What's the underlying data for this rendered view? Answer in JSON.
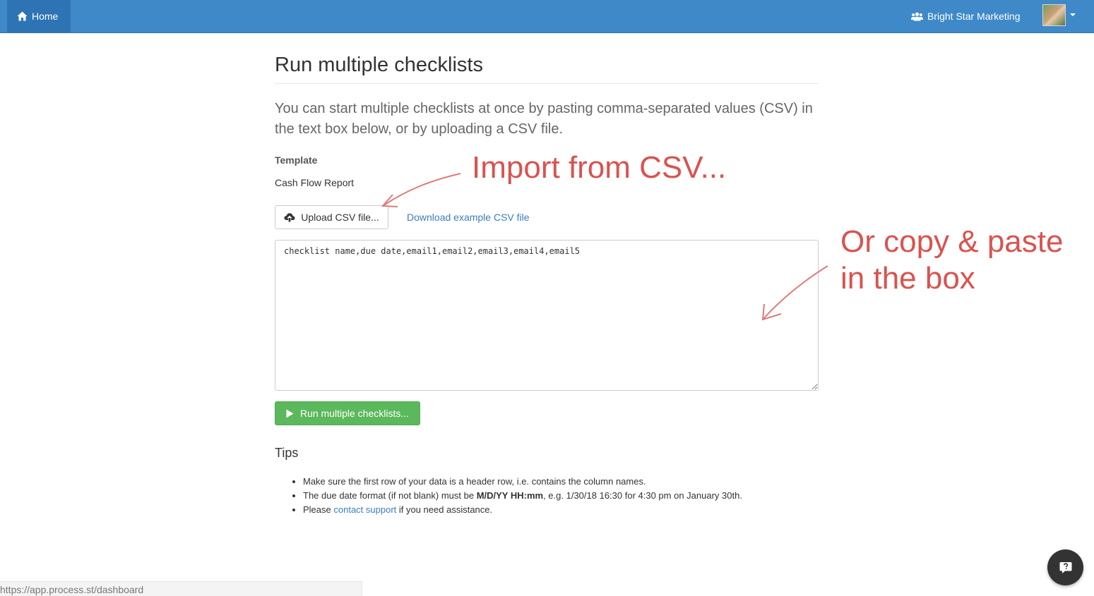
{
  "navbar": {
    "home_label": "Home",
    "org_name": "Bright Star Marketing"
  },
  "page": {
    "title": "Run multiple checklists",
    "lead": "You can start multiple checklists at once by pasting comma-separated values (CSV) in the text box below, or by uploading a CSV file.",
    "template_label": "Template",
    "template_name": "Cash Flow Report",
    "upload_button_label": "Upload CSV file...",
    "download_example_label": "Download example CSV file",
    "csv_value": "checklist name,due date,email1,email2,email3,email4,email5",
    "run_button_label": "Run multiple checklists..."
  },
  "tips": {
    "heading": "Tips",
    "tip1": "Make sure the first row of your data is a header row, i.e. contains the column names.",
    "tip2_before": "The due date format (if not blank) must be ",
    "tip2_bold": "M/D/YY HH:mm",
    "tip2_after": ", e.g. 1/30/18 16:30 for 4:30 pm on January 30th.",
    "tip3_before": "Please ",
    "tip3_link": "contact support",
    "tip3_after": " if you need assistance."
  },
  "annotations": {
    "import": "Import from CSV...",
    "paste_line1": "Or copy & paste",
    "paste_line2": "in the box",
    "color": "#d9534f"
  },
  "status_bar": {
    "url": "https://app.process.st/dashboard"
  },
  "colors": {
    "navbar": "#3f89c9",
    "navbar_active": "#2e74b5",
    "success": "#5cb85c",
    "link": "#3a7dc0"
  },
  "icons": [
    "home-icon",
    "users-icon",
    "cloud-upload-icon",
    "play-icon",
    "question-icon",
    "caret-down-icon"
  ]
}
